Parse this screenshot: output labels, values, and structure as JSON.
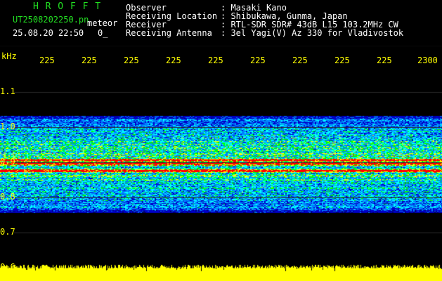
{
  "header": {
    "app_name": "H R O F F T",
    "filename": "UT2508202250.pn",
    "mode": "meteor",
    "datetime": "25.08.20 22:50",
    "counter": "0_",
    "fields": [
      {
        "label": "Observer",
        "value": ": Masaki Kano"
      },
      {
        "label": "Receiving Location",
        "value": ": Shibukawa, Gunma, Japan"
      },
      {
        "label": "Receiver",
        "value": ": RTL-SDR SDR# 43dB L15 103.2MHz CW"
      },
      {
        "label": "Receiving Antenna",
        "value": ": 3el Yagi(V) Az 330 for Vladivostok"
      }
    ]
  },
  "axes": {
    "y_unit": "kHz",
    "y_ticks": [
      "1.1",
      "1.0",
      "0.9",
      "0.8",
      "0.7",
      "0.6"
    ],
    "x_ticks": [
      "225",
      "225",
      "225",
      "225",
      "225",
      "225",
      "225",
      "225",
      "225",
      "2300"
    ]
  },
  "spectrogram": {
    "band_khz": [
      0.755,
      1.03
    ],
    "strong_lines_khz": [
      0.905,
      0.895,
      0.875
    ],
    "color_scale": [
      "#000070",
      "#0000c8",
      "#0080ff",
      "#00ffff",
      "#00ff00",
      "#ffff00",
      "#ff0000"
    ]
  },
  "colors": {
    "header_title": "#22e022",
    "header_text": "#ffffff",
    "ticks": "#ffff00",
    "noise_bar": "#ffff00",
    "background": "#000000"
  }
}
